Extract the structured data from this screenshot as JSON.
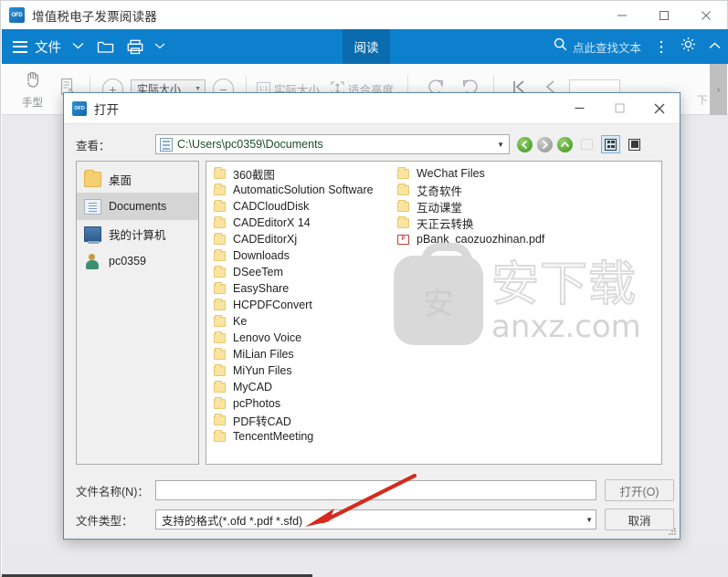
{
  "app": {
    "icon": "ofd-app-icon",
    "icon_text": "OFD",
    "title": "增值税电子发票阅读器",
    "window_controls": {
      "minimize": "—",
      "maximize": "▢",
      "close": "✕"
    }
  },
  "ribbon": {
    "menu_icon": "hamburger-icon",
    "file_label": "文件",
    "file_caret": "⌄",
    "open_icon": "folder-open-icon",
    "print_icon": "printer-icon",
    "more_caret": "▿",
    "active_tab": "阅读",
    "search_icon": "search-icon",
    "search_placeholder": "点此查找文本",
    "overflow_icon": "more-vertical-icon",
    "settings_icon": "gear-icon",
    "collapse_icon": "chevron-up-icon",
    "accent_color": "#0d80cd",
    "active_tab_color": "#0a6cae"
  },
  "toolbar": {
    "hand_tool": {
      "icon": "hand-icon",
      "label": "手型"
    },
    "select_tool": {
      "icon": "text-select-icon",
      "label": ""
    },
    "zoom_in": {
      "icon": "plus-circle-icon",
      "glyph": "+"
    },
    "zoom_value": "实际大小",
    "zoom_caret": "▾",
    "zoom_out": {
      "icon": "minus-circle-icon",
      "glyph": "−"
    },
    "actual_size": {
      "icon": "one-to-one-icon",
      "icon_text": "1:1",
      "label": "实际大小"
    },
    "fit_height": {
      "icon": "fit-height-icon",
      "label": "适合高度"
    },
    "rotate_cw": {
      "icon": "rotate-clockwise-icon"
    },
    "rotate_ccw": {
      "icon": "rotate-counterclockwise-icon"
    },
    "first_page": {
      "icon": "first-page-icon",
      "glyph": "|⟨"
    },
    "prev_page": {
      "icon": "prev-page-icon",
      "glyph": "⟨"
    },
    "page_input_value": "",
    "next_label": "下",
    "overflow_glyph": "›"
  },
  "dialog": {
    "icon": "ofd-dialog-icon",
    "icon_text": "OFD",
    "title": "打开",
    "window_controls": {
      "minimize": "—",
      "maximize": "▢",
      "close": "✕"
    },
    "lookin": {
      "label": "查看：",
      "path_icon": "path-document-icon",
      "path_value": "C:\\Users\\pc0359\\Documents",
      "caret": "▼"
    },
    "nav": {
      "back": {
        "icon": "back-arrow-icon",
        "glyph": "❮"
      },
      "forward": {
        "icon": "forward-arrow-icon",
        "glyph": "❯"
      },
      "up": {
        "icon": "up-arrow-icon",
        "glyph": "❮"
      },
      "new_folder": {
        "icon": "new-folder-icon"
      },
      "grid_view": {
        "icon": "grid-view-icon"
      },
      "detail_view": {
        "icon": "detail-view-icon"
      }
    },
    "shortcuts": [
      {
        "label": "桌面",
        "icon": "desktop-folder-icon",
        "selected": false
      },
      {
        "label": "Documents",
        "icon": "documents-icon",
        "selected": true
      },
      {
        "label": "我的计算机",
        "icon": "my-computer-icon",
        "selected": false
      },
      {
        "label": "pc0359",
        "icon": "user-folder-icon",
        "selected": false
      }
    ],
    "files_column_1": [
      {
        "name": "360截图",
        "type": "folder"
      },
      {
        "name": "AutomaticSolution Software",
        "type": "folder"
      },
      {
        "name": "CADCloudDisk",
        "type": "folder"
      },
      {
        "name": "CADEditorX 14",
        "type": "folder"
      },
      {
        "name": "CADEditorXj",
        "type": "folder"
      },
      {
        "name": "Downloads",
        "type": "folder"
      },
      {
        "name": "DSeeTem",
        "type": "folder"
      },
      {
        "name": "EasyShare",
        "type": "folder"
      },
      {
        "name": "HCPDFConvert",
        "type": "folder"
      },
      {
        "name": "Ke",
        "type": "folder"
      },
      {
        "name": "Lenovo Voice",
        "type": "folder"
      },
      {
        "name": "MiLian Files",
        "type": "folder"
      },
      {
        "name": "MiYun Files",
        "type": "folder"
      },
      {
        "name": "MyCAD",
        "type": "folder"
      },
      {
        "name": "pcPhotos",
        "type": "folder"
      },
      {
        "name": "PDF转CAD",
        "type": "folder"
      },
      {
        "name": "TencentMeeting",
        "type": "folder"
      }
    ],
    "files_column_2": [
      {
        "name": "WeChat Files",
        "type": "folder"
      },
      {
        "name": "艾奇软件",
        "type": "folder"
      },
      {
        "name": "互动课堂",
        "type": "folder"
      },
      {
        "name": "天正云转换",
        "type": "folder"
      },
      {
        "name": "pBank_caozuozhinan.pdf",
        "type": "pdf",
        "icon_text": "P"
      }
    ],
    "filename_row": {
      "label": "文件名称(N)：",
      "value": "",
      "button": "打开(O)"
    },
    "filetype_row": {
      "label": "文件类型：",
      "value": "支持的格式(*.ofd *.pdf *.sfd)",
      "caret": "▼",
      "button": "取消"
    }
  },
  "watermark": {
    "logo_char": "安",
    "text": "安下载",
    "subtext": "anxz.com"
  },
  "annotation": {
    "arrow_color": "#d42b1e"
  }
}
